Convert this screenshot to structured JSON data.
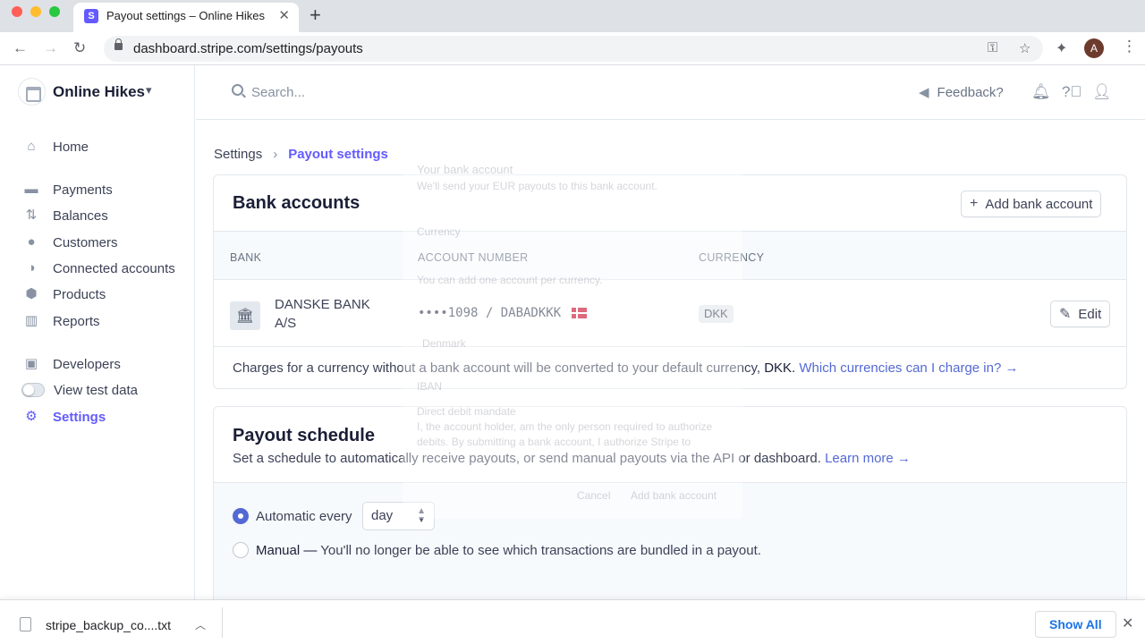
{
  "browser": {
    "tab_title": "Payout settings – Online Hikes",
    "favicon_letter": "S",
    "url": "dashboard.stripe.com/settings/payouts",
    "profile_initial": "A"
  },
  "account": {
    "name": "Online Hikes"
  },
  "sidebar": {
    "items": [
      {
        "label": "Home",
        "icon": "home-icon"
      },
      {
        "label": "Payments",
        "icon": "payments-icon"
      },
      {
        "label": "Balances",
        "icon": "balances-icon"
      },
      {
        "label": "Customers",
        "icon": "customers-icon"
      },
      {
        "label": "Connected accounts",
        "icon": "connected-accounts-icon"
      },
      {
        "label": "Products",
        "icon": "products-icon"
      },
      {
        "label": "Reports",
        "icon": "reports-icon"
      },
      {
        "label": "Developers",
        "icon": "terminal-icon"
      },
      {
        "label": "View test data",
        "icon": "toggle"
      },
      {
        "label": "Settings",
        "icon": "gear-icon",
        "active": true
      }
    ]
  },
  "header": {
    "search_placeholder": "Search...",
    "feedback": "Feedback?"
  },
  "breadcrumb": {
    "parent": "Settings",
    "current": "Payout settings"
  },
  "bank_accounts": {
    "title": "Bank accounts",
    "add_button": "Add bank account",
    "columns": [
      "BANK",
      "ACCOUNT NUMBER",
      "CURRENCY"
    ],
    "row": {
      "bank": "DANSKE BANK A/S",
      "account": "••••1098 / DABADKKK",
      "currency": "DKK",
      "edit": "Edit"
    },
    "note_prefix": "Charges for a currency without a bank account will be converted to your default currency,",
    "note_currency": "DKK.",
    "note_link": "Which currencies can I charge in? →"
  },
  "payout_schedule": {
    "title": "Payout schedule",
    "subtitle": "Set a schedule to automatically receive payouts, or send manual payouts via the API or dashboard.",
    "learn_more": "Learn more →",
    "automatic_label": "Automatic every",
    "interval": "day",
    "manual_label": "Manual —",
    "manual_desc": "You'll no longer be able to see which transactions are bundled in a payout."
  },
  "ghost_modal": {
    "title": "Your bank account",
    "subtitle": "We'll send your EUR payouts to this bank account.",
    "currency_label": "Currency",
    "currency_hint": "You can add one account per currency.",
    "country": "Denmark",
    "iban": "IBAN",
    "mandate_title": "Direct debit mandate",
    "mandate_l1": "I, the account holder, am the only person required to authorize",
    "mandate_l2": "debits. By submitting a bank account, I authorize Stripe to",
    "cancel": "Cancel",
    "submit": "Add bank account"
  },
  "downloads": {
    "file": "stripe_backup_co....txt",
    "show_all": "Show All"
  },
  "colors": {
    "accent": "#635bff",
    "link": "#5469d4",
    "radio": "#5469d4"
  }
}
